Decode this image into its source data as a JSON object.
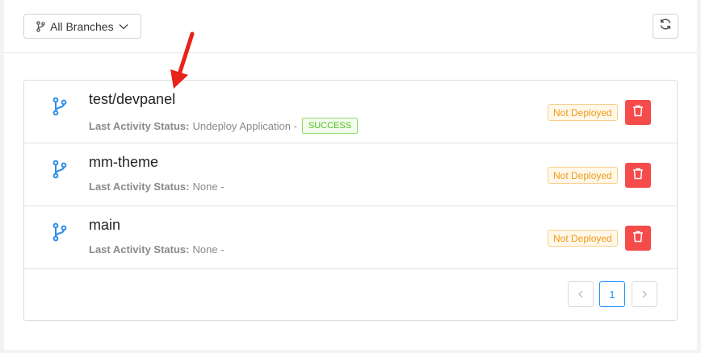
{
  "toolbar": {
    "branch_filter_label": "All Branches",
    "branch_filter_icon": "git-branch-icon",
    "dropdown_icon": "chevron-down-icon",
    "refresh_icon": "refresh-icon"
  },
  "branches": [
    {
      "name": "test/devpanel",
      "activity_label": "Last Activity Status:",
      "activity_value": "Undeploy Application -",
      "activity_result": "SUCCESS",
      "status": "Not Deployed"
    },
    {
      "name": "mm-theme",
      "activity_label": "Last Activity Status:",
      "activity_value": "None -",
      "status": "Not Deployed"
    },
    {
      "name": "main",
      "activity_label": "Last Activity Status:",
      "activity_value": "None -",
      "status": "Not Deployed"
    }
  ],
  "pagination": {
    "current_page": "1"
  },
  "colors": {
    "accent": "#1890ff",
    "danger": "#f54b4b",
    "warning": "#ef9b1b",
    "success": "#4fc21e",
    "annotation_arrow": "#e8231a"
  }
}
